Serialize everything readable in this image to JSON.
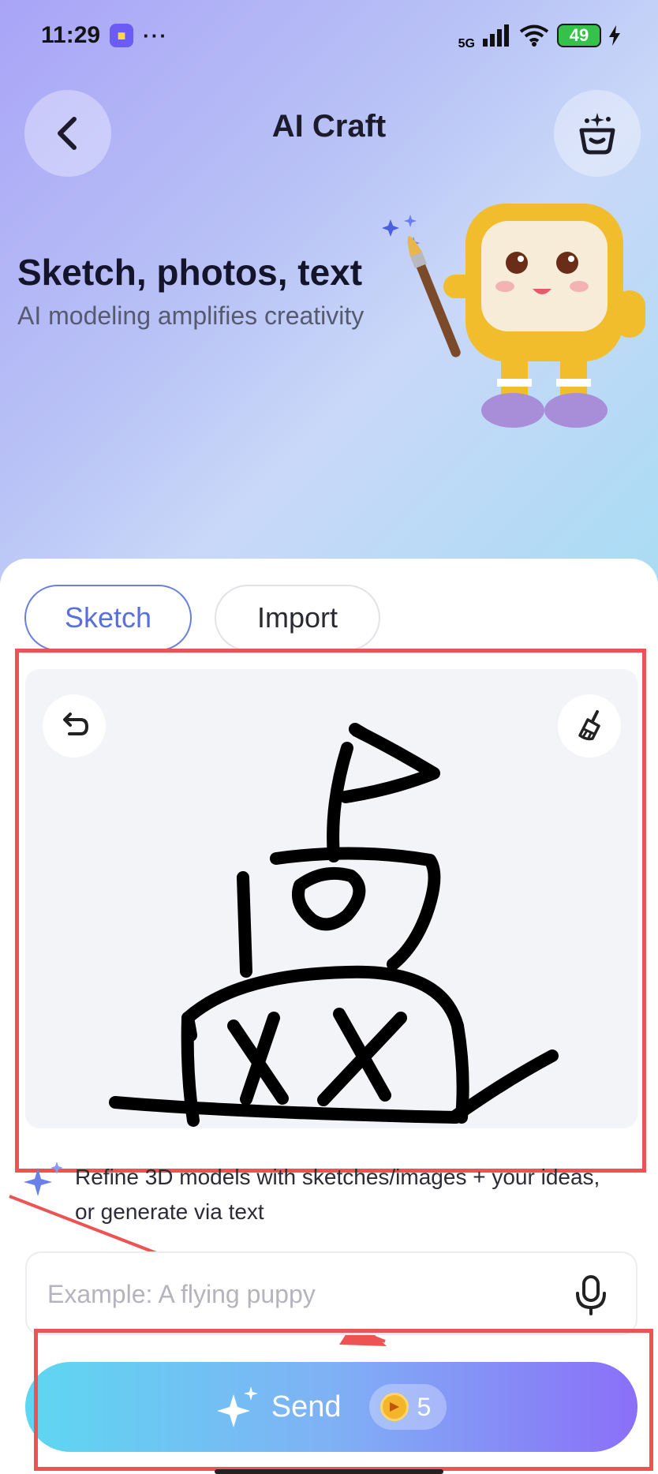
{
  "status_bar": {
    "time": "11:29",
    "dots": "···",
    "network": "5G",
    "battery": "49"
  },
  "header": {
    "title": "AI Craft"
  },
  "hero": {
    "heading": "Sketch, photos, text",
    "subheading": "AI modeling amplifies creativity"
  },
  "tabs": [
    {
      "label": "Sketch",
      "active": true
    },
    {
      "label": "Import",
      "active": false
    }
  ],
  "hint": {
    "text": "Refine 3D models with sketches/images + your ideas, or generate via text"
  },
  "prompt": {
    "placeholder": "Example: A flying puppy",
    "value": ""
  },
  "send": {
    "label": "Send",
    "cost": "5"
  },
  "colors": {
    "accent": "#5a6fde",
    "annotation": "#ee5353",
    "send_gradient_start": "#5ed7f1",
    "send_gradient_end": "#8b6ff8"
  }
}
